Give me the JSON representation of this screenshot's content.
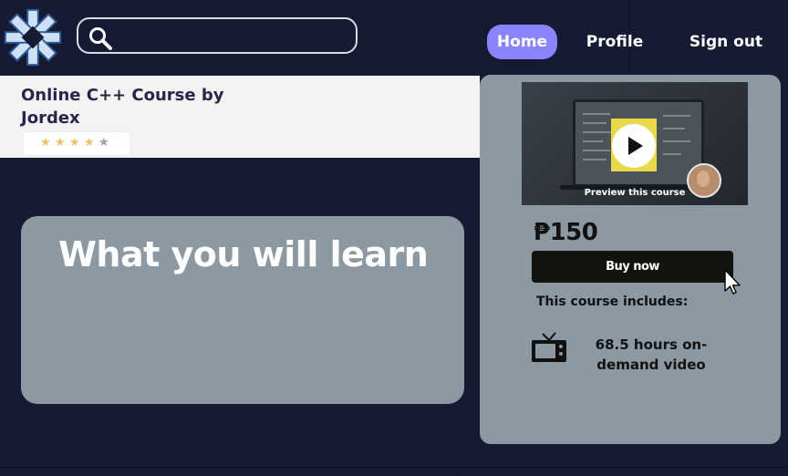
{
  "header": {
    "logo_icon": "star-knot-logo-icon",
    "search": {
      "placeholder": "",
      "value": "",
      "icon": "search-icon"
    },
    "nav": {
      "home": "Home",
      "profile": "Profile",
      "signout": "Sign out"
    }
  },
  "course": {
    "title": "Online C++ Course by\n Jordex",
    "rating": {
      "stars_filled": 4,
      "stars_total": 5,
      "filled_color": "#f4c063",
      "empty_color": "#9aa3ad"
    }
  },
  "learn": {
    "heading": "What you will learn"
  },
  "purchase": {
    "preview_label": "Preview this course",
    "price": "₱150",
    "buy_label": "Buy now",
    "includes_label": "This course includes:",
    "includes": [
      {
        "icon": "tv-icon",
        "text": "68.5 hours on-demand video"
      }
    ]
  },
  "colors": {
    "background": "#161a33",
    "accent": "#8b84ff",
    "card": "#8c99a3",
    "button": "#13130f"
  }
}
